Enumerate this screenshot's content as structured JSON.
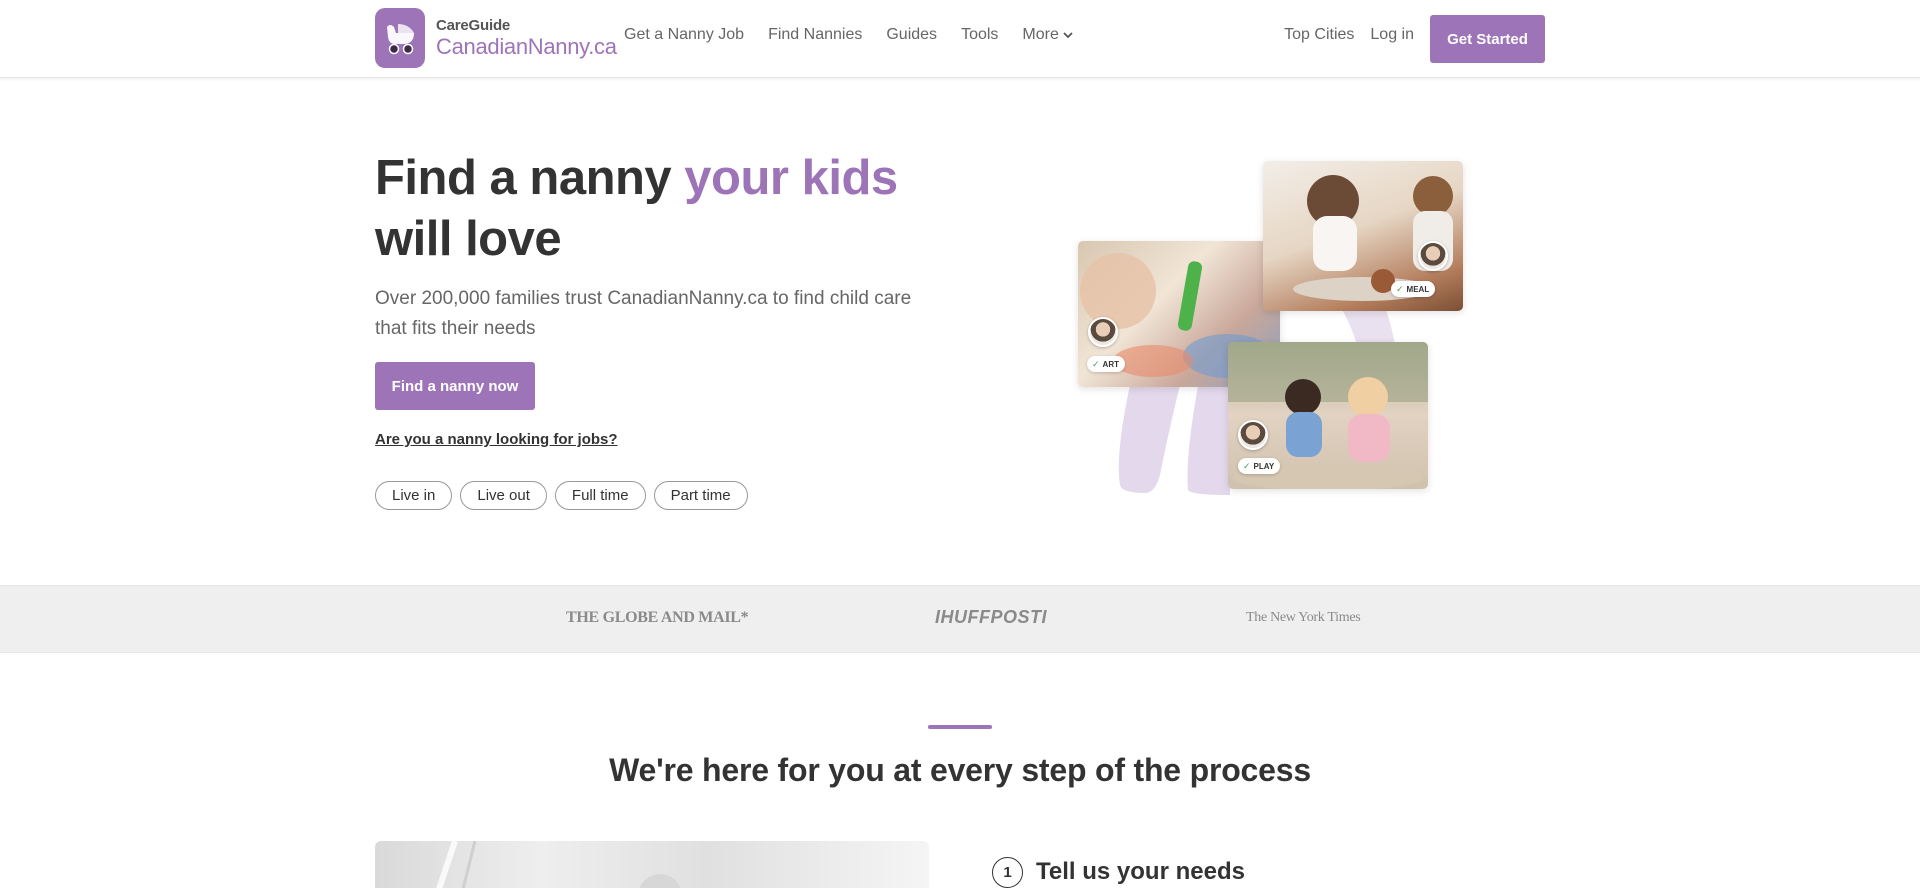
{
  "brand": {
    "line1": "CareGuide",
    "line2": "CanadianNanny.ca",
    "color": "#9e74b8"
  },
  "nav": {
    "left": [
      "Get a Nanny Job",
      "Find Nannies",
      "Guides",
      "Tools"
    ],
    "more": "More",
    "right": [
      "Top Cities",
      "Log in"
    ],
    "cta": "Get Started"
  },
  "hero": {
    "title_part1": "Find a nanny ",
    "title_accent": "your kids",
    "title_part2": "will love",
    "subtitle": "Over 200,000 families trust CanadianNanny.ca to find child care that fits their needs",
    "button": "Find a nanny now",
    "nanny_link": "Are you a nanny looking for jobs?",
    "pills": [
      "Live in",
      "Live out",
      "Full time",
      "Part time"
    ]
  },
  "collage": {
    "tags": {
      "art": "ART",
      "meal": "MEAL",
      "play": "PLAY"
    }
  },
  "press": {
    "globe": "THE GLOBE AND MAIL*",
    "huff": "IHUFFPOSTI",
    "nyt": "The New York Times"
  },
  "process": {
    "title": "We're here for you at every step of the process",
    "step1_number": "1",
    "step1_title": "Tell us your needs"
  }
}
